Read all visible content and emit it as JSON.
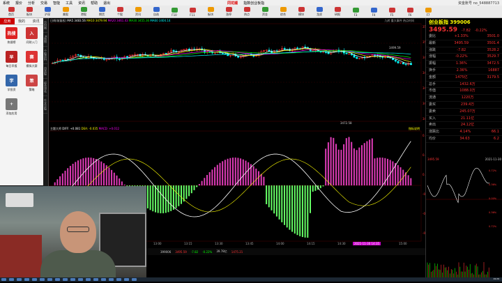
{
  "menu": {
    "items": [
      "系统",
      "报价",
      "分析",
      "交易",
      "智能",
      "工具",
      "资讯",
      "帮助",
      "退出"
    ],
    "brand": "同花顺",
    "brand_sub": "指数创业板指",
    "account": "资金账号  no_548887713"
  },
  "toolbar": {
    "items": [
      "首页",
      "板块",
      "沪深",
      "美股",
      "港股",
      "期货",
      "个股",
      "资讯",
      "自选",
      "F10",
      "F11",
      "板块",
      "涨停",
      "热点",
      "资金",
      "综合",
      "模块",
      "龙虎",
      "研报",
      "F3",
      "F4",
      "F5",
      "F6",
      "F7"
    ]
  },
  "apps": {
    "tabs": [
      "应用",
      "我的",
      "资讯"
    ],
    "items": [
      {
        "icon": "热搜",
        "label": "热搜榜",
        "color": "#d22"
      },
      {
        "icon": "入",
        "label": "问财入门",
        "color": "#c33"
      },
      {
        "icon": "早",
        "label": "每日早报",
        "color": "#b22"
      },
      {
        "icon": "赛",
        "label": "模拟大赛",
        "color": "#d33"
      },
      {
        "icon": "学",
        "label": "学投资",
        "color": "#36a"
      },
      {
        "icon": "策",
        "label": "策略",
        "color": "#c44"
      },
      {
        "icon": "+",
        "label": "添加应用",
        "color": "#777"
      }
    ]
  },
  "side_tabs": [
    "分时图",
    "K线图",
    "个股资料",
    "自选股",
    "综合排名",
    "牛叉诊股"
  ],
  "chart": {
    "legend_k": {
      "prefix": "日线(前复权)",
      "ma5_label": "MA5 3483.56",
      "ma10_label": "MA10 3479.94",
      "ma20_label": "MA20 3461.43",
      "ma30_label": "MA30 3455.36",
      "ma60_label": "MA60 3404.14"
    },
    "top_tabs": "九转  重大事件  热点时间",
    "price_high_label": "3499.59",
    "price_low_label": "3472.58",
    "legend_macd": {
      "prefix": "主题大师",
      "dif": "DIFF: +0.081",
      "dea": "DEA: -0.035",
      "macd": "MACD: +0.012"
    },
    "indicator_name": "指标说明",
    "right_axis_labels": [
      "3510",
      "3500",
      "3490",
      "3480",
      "3470",
      "3460",
      "3450"
    ],
    "right_axis2_labels": [
      "0.012",
      "0.006",
      "0.000",
      "-0.006",
      "-0.012",
      "-0.018"
    ],
    "x_labels": [
      "13:00",
      "13:15",
      "13:30",
      "13:45",
      "14:00",
      "14:15",
      "14:30",
      "14:45",
      "15:00"
    ],
    "x_current": "2021-11-30 14:35",
    "bottom_strip": {
      "code": "399006",
      "price": "3495.59",
      "change": "-7.82",
      "pct": "-0.22%",
      "vol": "39.78亿",
      "amount": "1475.21"
    }
  },
  "right_panel": {
    "title": "创业板指 399006",
    "price": "3495.59",
    "change": "-7.82",
    "pct": "-0.22%",
    "rows": [
      {
        "k": "委比",
        "v": "+1.33%",
        "v2": "3501.0"
      },
      {
        "k": "最新",
        "v": "3495.59",
        "v2": "3501.4"
      },
      {
        "k": "涨跌",
        "v": "-7.82",
        "v2": "3528.2"
      },
      {
        "k": "涨幅",
        "v": "-0.22%",
        "v2": "3529.7"
      },
      {
        "k": "振幅",
        "v": "1.36%",
        "v2": "3472.5"
      },
      {
        "k": "换手",
        "v": "2.36%",
        "v2": "16887"
      },
      {
        "k": "金额",
        "v": "1475亿",
        "v2": "3179.5"
      },
      {
        "k": "总手",
        "v": "1432.6万",
        "v2": ""
      },
      {
        "k": "市值",
        "v": "1088.0万",
        "v2": ""
      },
      {
        "k": "流通",
        "v": "1220万",
        "v2": ""
      },
      {
        "k": "委买",
        "v": "239.4万",
        "v2": ""
      },
      {
        "k": "委卖",
        "v": "245.07万",
        "v2": ""
      },
      {
        "k": "买入",
        "v": "21.11亿",
        "v2": ""
      },
      {
        "k": "卖出",
        "v": "24.12亿",
        "v2": ""
      },
      {
        "k": "涨跌比",
        "v": "4.14%",
        "v2": "66.1"
      },
      {
        "k": "均价",
        "v": "34.63",
        "v2": "6.2"
      }
    ],
    "mini_chart": {
      "price": "3495.59",
      "date": "2021-11-30",
      "right_labels": [
        "0.72%",
        "0.36%",
        "0.00%",
        "0.36%",
        "0.72%"
      ]
    }
  },
  "clock": "19:29"
}
